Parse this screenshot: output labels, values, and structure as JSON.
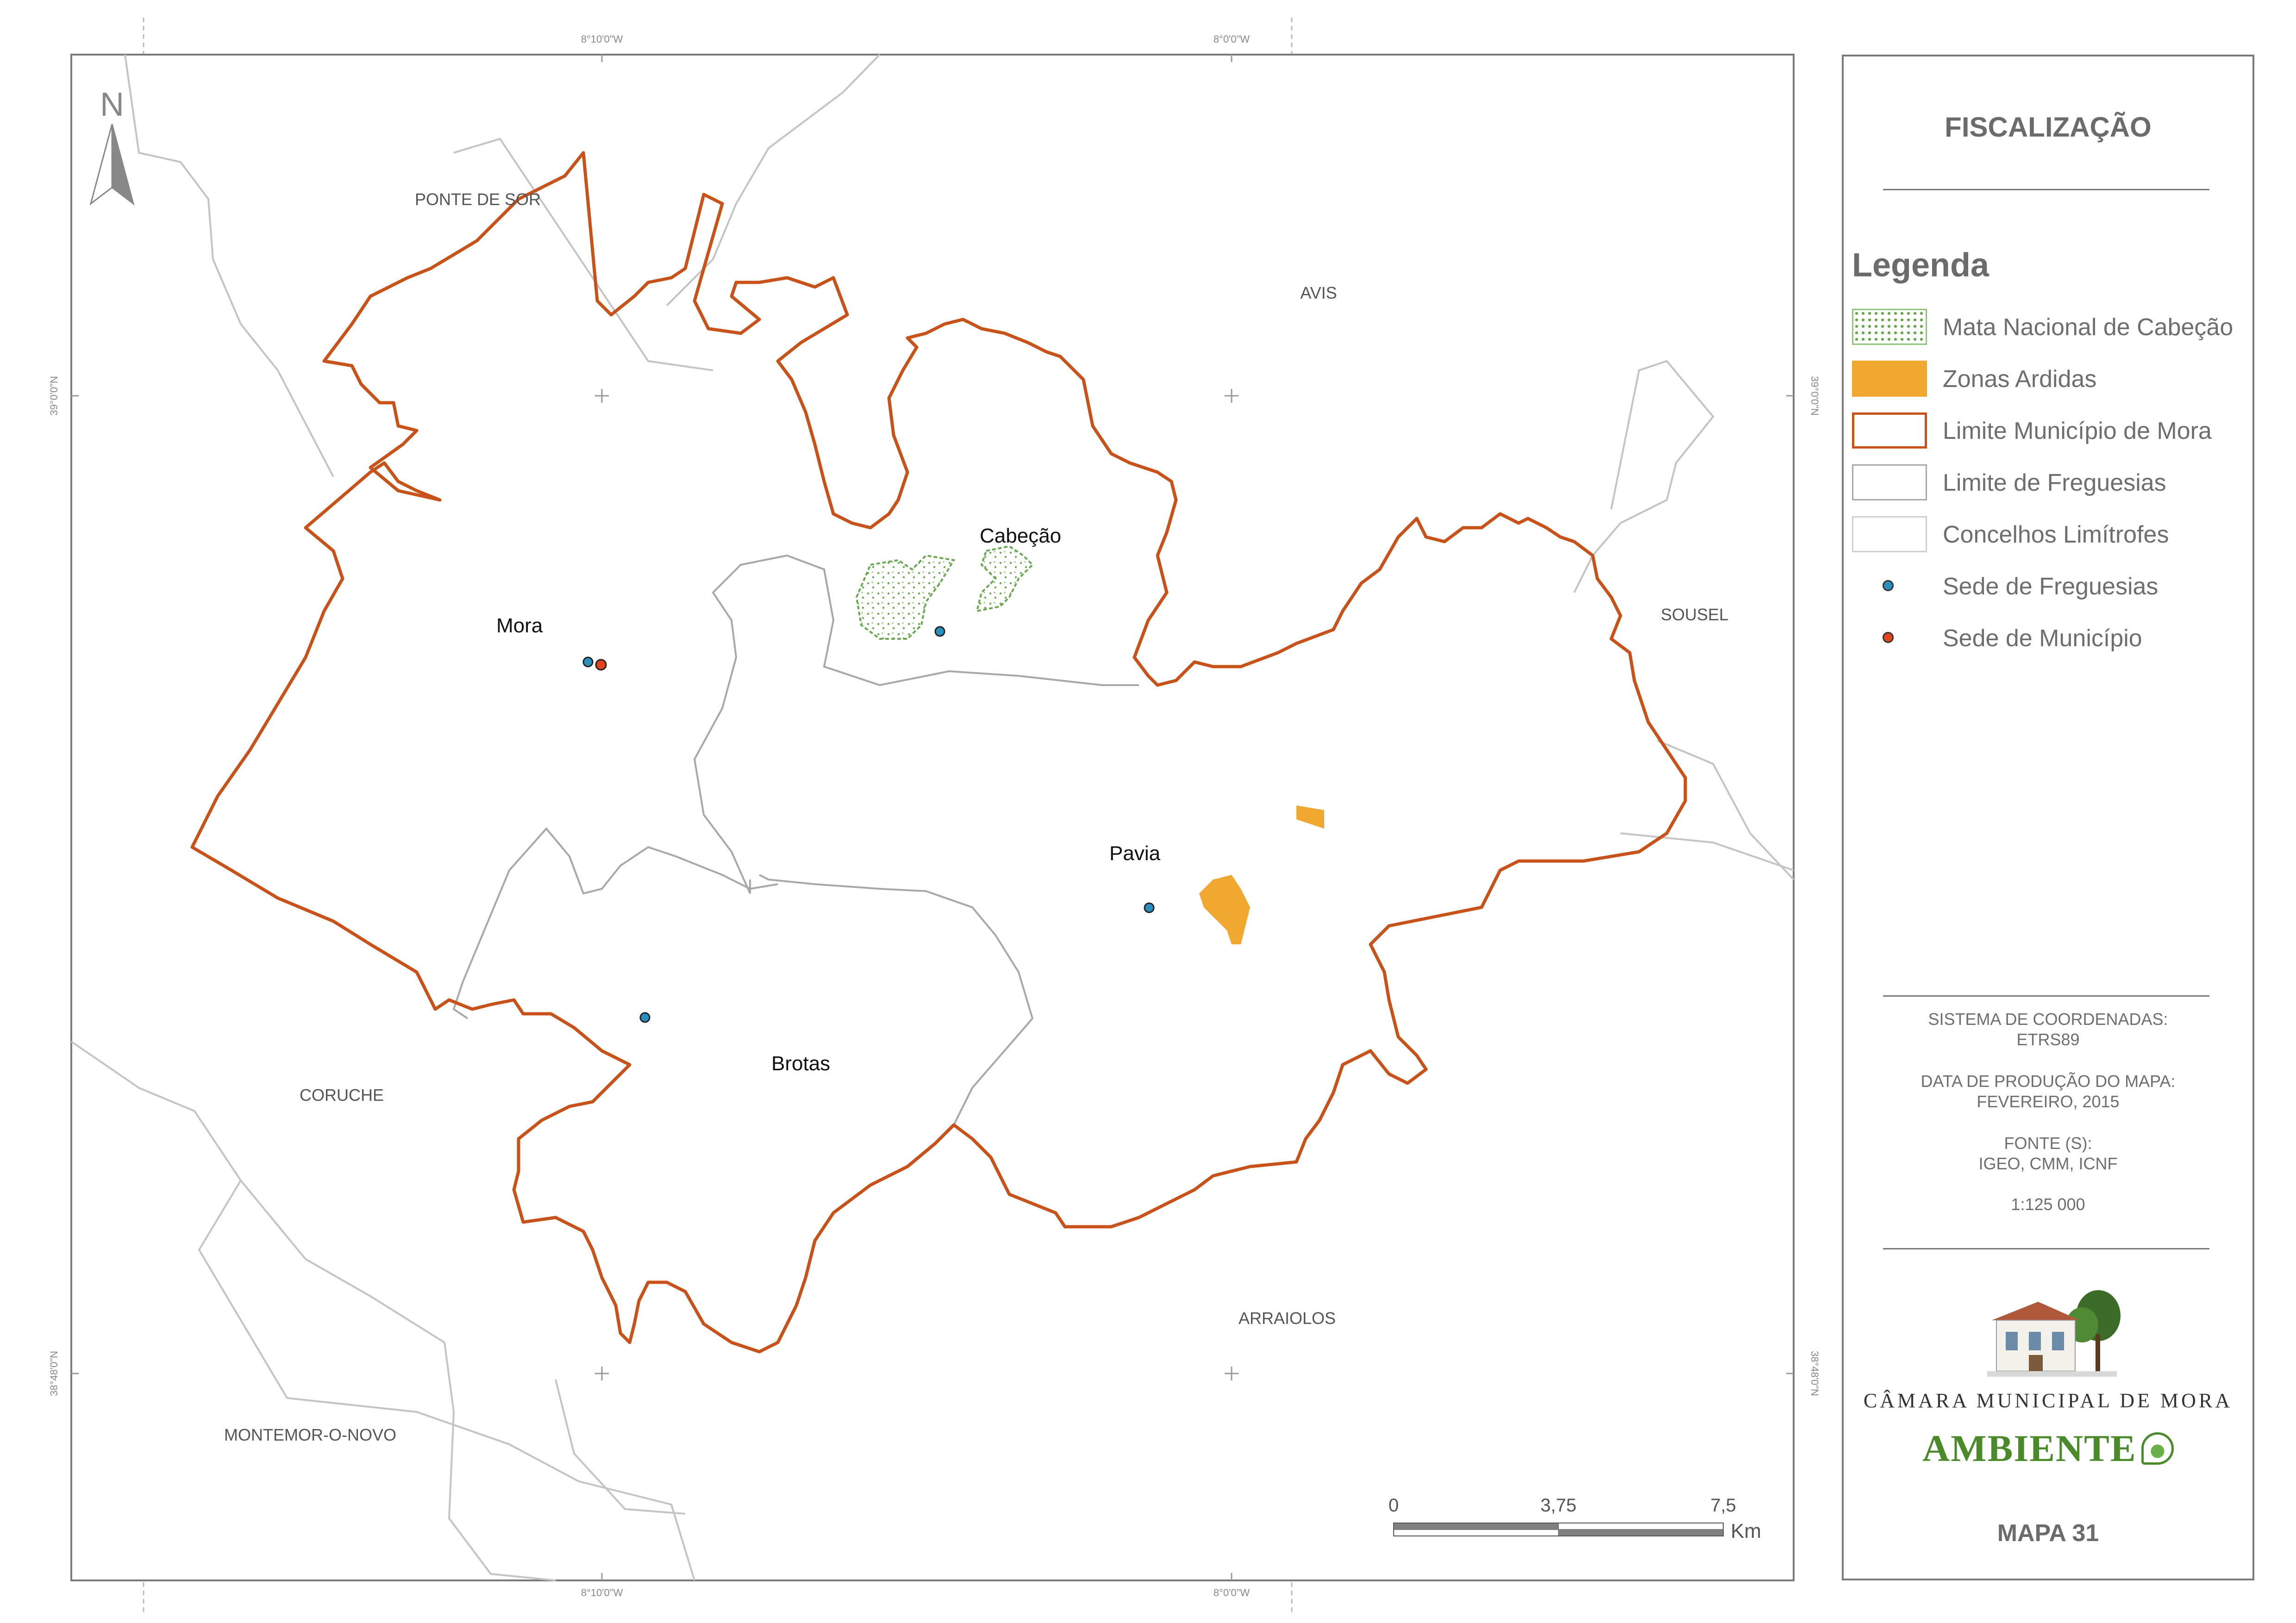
{
  "map": {
    "north_label": "N",
    "neighbors": {
      "ponte_de_sor": "PONTE DE SOR",
      "avis": "AVIS",
      "sousel": "SOUSEL",
      "coruche": "CORUCHE",
      "arraiolos": "ARRAIOLOS",
      "montemor": "MONTEMOR-O-NOVO"
    },
    "parishes": {
      "mora": "Mora",
      "cabecao": "Cabeção",
      "pavia": "Pavia",
      "brotas": "Brotas"
    },
    "grid": {
      "lon_1": "8°10'0\"W",
      "lon_2": "8°0'0\"W",
      "lat_1": "39°0'0\"N",
      "lat_2": "38°48'0\"N"
    },
    "scalebar": {
      "tick_0": "0",
      "tick_mid": "3,75",
      "tick_max": "7,5",
      "unit": "Km"
    },
    "colors": {
      "municipality_boundary": "#c8531a",
      "parish_boundary": "#a8a8a8",
      "burned_zones": "#f0a830",
      "mata_nacional": "#8fc47a",
      "sede_freguesia": "#2a8fbf",
      "sede_municipio": "#e0441a"
    }
  },
  "panel": {
    "title": "FISCALIZAÇÃO",
    "legend_title": "Legenda",
    "legend": [
      {
        "label": "Mata Nacional de Cabeção",
        "icon": "dotted-green-fill"
      },
      {
        "label": "Zonas Ardidas",
        "icon": "orange-fill"
      },
      {
        "label": "Limite Município de Mora",
        "icon": "orange-outline"
      },
      {
        "label": "Limite de Freguesias",
        "icon": "grey-outline"
      },
      {
        "label": "Concelhos Limítrofes",
        "icon": "light-grey-outline"
      },
      {
        "label": "Sede de Freguesias",
        "icon": "blue-dot"
      },
      {
        "label": "Sede de Município",
        "icon": "red-dot"
      }
    ],
    "info": {
      "coord_label": "SISTEMA DE COORDENADAS:",
      "coord_value": "ETRS89",
      "date_label": "DATA DE PRODUÇÃO DO MAPA:",
      "date_value": "FEVEREIRO, 2015",
      "source_label": "FONTE (S):",
      "source_value": "IGEO, CMM, ICNF",
      "scale": "1:125 000"
    },
    "logo": {
      "org": "CÂMARA MUNICIPAL DE MORA",
      "brand": "AMBIENTE"
    },
    "map_number": "MAPA 31"
  }
}
